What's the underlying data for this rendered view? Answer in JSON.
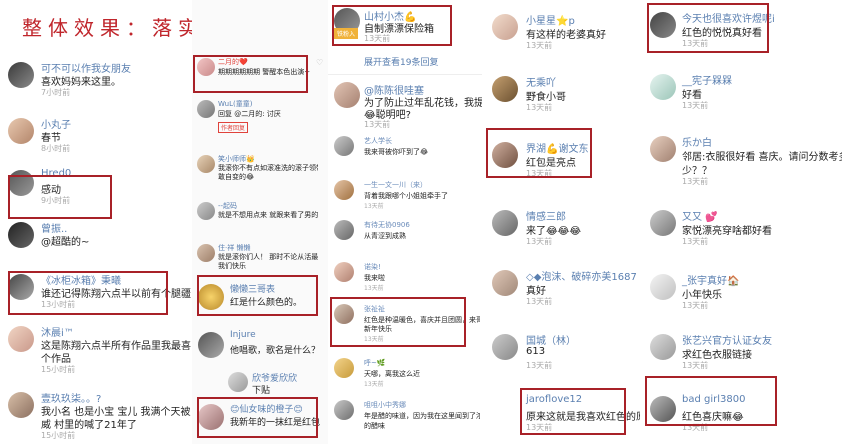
{
  "title": "整体效果：落实口碑",
  "col1": [
    {
      "name": "可不可以作我女朋友",
      "text": "喜欢妈妈来这里。",
      "time": "7小时前"
    },
    {
      "name": "小丸子",
      "text": "春节",
      "time": "8小时前"
    },
    {
      "name": "Hred0",
      "text": "感动",
      "time": "9小时前"
    },
    {
      "name": "曾振..",
      "text": "@超酷的~",
      "time": ""
    },
    {
      "name": "《冰柜冰箱》秉曦",
      "text": "谁还记得陈翔六点半以前有个腿疆",
      "time": "13小时前"
    },
    {
      "name": "沐晨i™",
      "text": "这是陈翔六点半所有作品里我最喜欢的一",
      "text2": "个作品",
      "time": "15小时前"
    },
    {
      "name": "壹玖玖柒。。?",
      "text": "我小名 也是小宝 宝儿  我满个天被所有",
      "text2": "威 村里的喊了21年了",
      "time": "15小时前"
    }
  ],
  "col2": [
    {
      "name": "二月的❤️",
      "text": "期期期期期期 警醒本色出演~",
      "time": ""
    },
    {
      "name": "WuL(童童)",
      "text": "回复 @二月的: 讨厌",
      "time": ""
    },
    {
      "name": "",
      "text": "作者回复",
      "time": ""
    },
    {
      "name": "笑小师师👑",
      "text": "我滚你不有点如滚准洗的滚子领带点滚子",
      "text2": "敢自变的😂",
      "time": ""
    },
    {
      "name": "--起码",
      "text": "就是不想用点来 就跟来看了男的",
      "time": ""
    },
    {
      "name": "住·祥 懒懒",
      "text": "就是滚你们人！ 那时不论从活最",
      "text2": "我们快乐",
      "time": ""
    },
    {
      "name": "懒懒三哥表",
      "text": "红是什么颜色的。",
      "time": ""
    },
    {
      "name": "Injure",
      "text": "他唱歌，歌名是什么？",
      "time": ""
    },
    {
      "name": "欣爷爱欣欣",
      "text": "下贴",
      "time": ""
    },
    {
      "name": "😊仙女味的橙子😊",
      "text": "我新年的一抹红是红包",
      "time": ""
    }
  ],
  "col3": [
    {
      "name": "山村小杰💪",
      "text": "自制漂漂保险箱",
      "time": "13天前",
      "badge": "铁粉入"
    },
    {
      "expand": "展开查看19条回复"
    },
    {
      "name": "@陈陈很哇塞",
      "text": "为了防止过年乱花钱，我提前把",
      "text2": "😂聪明吧?",
      "time": "13天前"
    },
    {
      "name": "艺人学长",
      "text": "我来哥被你吓到了😂",
      "time": ""
    },
    {
      "name": "一生一文一川（来）",
      "text": "背着我跟哪个小姐姐牵手了",
      "time": "13天前"
    },
    {
      "name": "有待无协0906",
      "text": "从青涩到成熟",
      "time": ""
    },
    {
      "name": "诺染!",
      "text": "我来啦",
      "time": "13天前"
    },
    {
      "name": "张祉祉",
      "text": "红色是种温暖色，喜庆并且团圆，来哥",
      "text2": "新年快乐",
      "time": "13天前"
    },
    {
      "name": "呼~🌿",
      "text": "天哪，离我这么近",
      "time": "13天前"
    },
    {
      "name": "咀咀小中秀娜",
      "text": "年是醋的味道，因为我在这里闻到了浓",
      "text2": "的醋味",
      "time": ""
    }
  ],
  "col4": [
    {
      "name": "小星星⭐p",
      "text": "有这样的老婆真好",
      "time": "13天前"
    },
    {
      "name": "无乘吖",
      "text": "野食小哥",
      "time": "13天前"
    },
    {
      "name": "界湖💪谢文东",
      "text": "红包是亮点",
      "time": "13天前"
    },
    {
      "name": "情感三郎",
      "text": "来了😂😂😂",
      "time": "13天前"
    },
    {
      "name": "◇◆泡沫、破碎亦美1687",
      "text": "真好",
      "time": "13天前"
    },
    {
      "name": "国城（林）",
      "text": "613",
      "time": "13天前"
    },
    {
      "name": "jaroflove12",
      "text": "原来这就是我喜欢红色的原",
      "time": "13天前"
    }
  ],
  "col5": [
    {
      "name": "今天也很喜欢许煜呢i",
      "text": "红色的悦悦真好看",
      "time": "13天前"
    },
    {
      "name": "__宪子槑槑",
      "text": "好看",
      "time": "13天前"
    },
    {
      "name": "乐か白",
      "text": "邻居:衣服很好看 喜庆。请问分数考多",
      "text2": "少？？",
      "time": "13天前"
    },
    {
      "name": "又又 💕",
      "text": "家悦漂亮穿啥都好看",
      "time": "13天前"
    },
    {
      "name": "_张宇真好🏠",
      "text": "小年快乐",
      "time": "13天前"
    },
    {
      "name": "张艺兴官方认证女友",
      "text": "求红色衣服链接",
      "time": "13天前"
    },
    {
      "name": "bad girl3800",
      "text": "红色喜庆嘛😂",
      "time": "13天前"
    }
  ]
}
